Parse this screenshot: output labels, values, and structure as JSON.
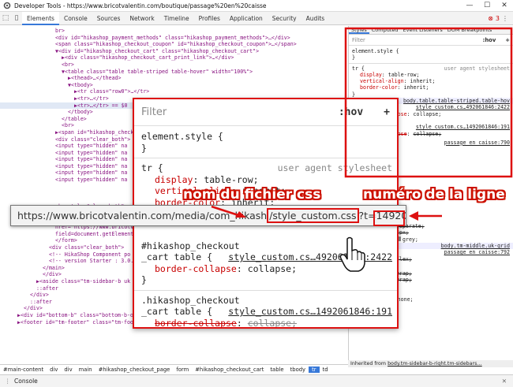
{
  "window": {
    "title": "Developer Tools - https://www.bricotvalentin.com/boutique/passage%20en%20caisse",
    "minimize": "—",
    "maximize": "☐",
    "close": "✕"
  },
  "toolbar": {
    "tabs": [
      "Elements",
      "Console",
      "Sources",
      "Network",
      "Timeline",
      "Profiles",
      "Application",
      "Security",
      "Audits"
    ],
    "error_count": "3",
    "menu": "⋮"
  },
  "dom_lines": [
    {
      "i": 0,
      "t": "br>"
    },
    {
      "i": 0,
      "t": "<div id=\"hikashop_payment_methods\" class=\"hikashop_payment_methods\">…</div>"
    },
    {
      "i": 0,
      "t": "<span class=\"hikashop_checkout_coupon\" id=\"hikashop_checkout_coupon\">…</span>"
    },
    {
      "i": 0,
      "t": "▼<div id=\"hikashop_checkout_cart\" class=\"hikashop_checkout_cart\">"
    },
    {
      "i": 1,
      "t": "▶<div class=\"hikashop_checkout_cart_print_link\">…</div>"
    },
    {
      "i": 1,
      "t": "<br>"
    },
    {
      "i": 1,
      "t": "▼<table class=\"table table-striped table-hover\" width=\"100%\">"
    },
    {
      "i": 2,
      "t": "▶<thead>…</thead>"
    },
    {
      "i": 2,
      "t": "▼<tbody>"
    },
    {
      "i": 3,
      "t": "▶<tr class=\"row0\">…</tr>"
    },
    {
      "i": 3,
      "t": "▶<tr>…</tr>"
    },
    {
      "i": 3,
      "t": "▶<tr>…</tr> == $0",
      "sel": true
    },
    {
      "i": 2,
      "t": "</tbody>"
    },
    {
      "i": 1,
      "t": "</table>"
    },
    {
      "i": 1,
      "t": "<br>"
    },
    {
      "i": 0,
      "t": "▶<span id=\"hikashop_check"
    },
    {
      "i": 0,
      "t": "<div class=\"clear_both\">"
    },
    {
      "i": 0,
      "t": "<input type=\"hidden\" na"
    },
    {
      "i": 0,
      "t": "<input type=\"hidden\" na"
    },
    {
      "i": 0,
      "t": "<input type=\"hidden\" na"
    },
    {
      "i": 0,
      "t": "<input type=\"hidden\" na"
    },
    {
      "i": 0,
      "t": "<input type=\"hidden\" na"
    },
    {
      "i": 0,
      "t": "<input type=\"hidden\" na"
    },
    {
      "i": 0,
      "t": ""
    },
    {
      "i": 0,
      "t": ""
    },
    {
      "i": 0,
      "t": ""
    },
    {
      "i": 0,
      "t": "<br style=\"clear:both\">"
    },
    {
      "i": 0,
      "t": "▶<div class=\"hikashop_ch"
    },
    {
      "i": 0,
      "t": "<a rel=\"nofollow\" class"
    },
    {
      "i": 0,
      "t": "href=\"https://www.bricotv"
    },
    {
      "i": 0,
      "t": "field=document.getElement"
    },
    {
      "i": 0,
      "t": "</form>"
    },
    {
      "i": -1,
      "t": "<div class=\"clear_both\">"
    },
    {
      "i": -1,
      "t": "<!--  HikaShop Component po"
    },
    {
      "i": -1,
      "t": "<!-- version Starter : 3.0."
    },
    {
      "i": -2,
      "t": "</main>"
    },
    {
      "i": -2,
      "t": "</div>"
    },
    {
      "i": -3,
      "t": "▶<aside class=\"tm-sidebar-b uk"
    },
    {
      "i": -3,
      "t": "::after"
    },
    {
      "i": -4,
      "t": "</div>"
    },
    {
      "i": -4,
      "t": "::after"
    },
    {
      "i": -5,
      "t": "</div>"
    },
    {
      "i": -6,
      "t": "▶<div id=\"bottom-b\" class=\"bottom-b-outer uk-cover-background\">…</div>"
    },
    {
      "i": -6,
      "t": "▶<footer id=\"tm-footer\" class=\"tm-footer\">…</footer>"
    }
  ],
  "styles": {
    "tabs": [
      "Styles",
      "Computed",
      "Event Listeners",
      "DOM Breakpoints"
    ],
    "filter": "Filter",
    "hov": ":hov",
    ".cls": ".cls",
    "plus": "+",
    "element_style": "element.style {",
    "close": "}",
    "tr_selector": "tr {",
    "ua": "user agent stylesheet",
    "p1": "display",
    "v1": "table-row;",
    "p2": "vertical-align",
    "v2": "inherit;",
    "p3": "border-color",
    "v3": "inherit;",
    "src_table": "body.table.table-striped.table-hov",
    "src1": "style_custom.cs…492061846:2422",
    "p4": "border-collapse",
    "v4": "collapse;",
    "src2": "style_custom.cs…1492061846:191",
    "passage1": "passage en caisse:790",
    "passage2": "passage en caisse:792",
    "border_sep": "separate;",
    "bs2": "2px;",
    "grey": "grey;",
    "uk_grid": "body.tm-middle.uk-grid",
    "flex": "flex;",
    "wrap1": "wrap;",
    "wrap2": "wrap;",
    "padding": "0;",
    "list_style": "none;",
    "inherited_label": "Inherited from",
    "inherited_from": "body.tm-sidebar-b-right.tm-sidebars…"
  },
  "breadcrumbs": [
    "#main-content",
    "div",
    "div",
    "main",
    "#hikashop_checkout_page",
    "form",
    "#hikashop_checkout_cart",
    "table",
    "tbody",
    "tr",
    "td"
  ],
  "console_label": "Console",
  "zoom": {
    "filter": "Filter",
    "hov": ":hov",
    ".cls": ".cls",
    "plus": "+",
    "element_style": "element.style {",
    "close": "}",
    "tr_selector": "tr {",
    "ua": "user agent stylesheet",
    "p1": "display",
    "v1": "table-row;",
    "p2": "vertical-align",
    "v2": "inherit;",
    "p3": "border-color",
    "v3": "inherit;",
    "sel1a": "#hikashop_checkout",
    "src1": "style_custom.cs…492061846:2422",
    "sel1b": "_cart table {",
    "p4": "border-collapse",
    "v4": "collapse;",
    "sel2a": ".hikashop_checkout",
    "src2": "style_custom.cs…1492061846:191",
    "sel2b": "_cart table {"
  },
  "url": {
    "before": "https://www.bricotvalentin.com/media/com_hikash",
    "file": "/style_custom.css",
    "mid": "?t=1492061846:",
    "line": "2422"
  },
  "annotations": {
    "file": "nom du fichier css",
    "line": "numéro de la ligne"
  }
}
